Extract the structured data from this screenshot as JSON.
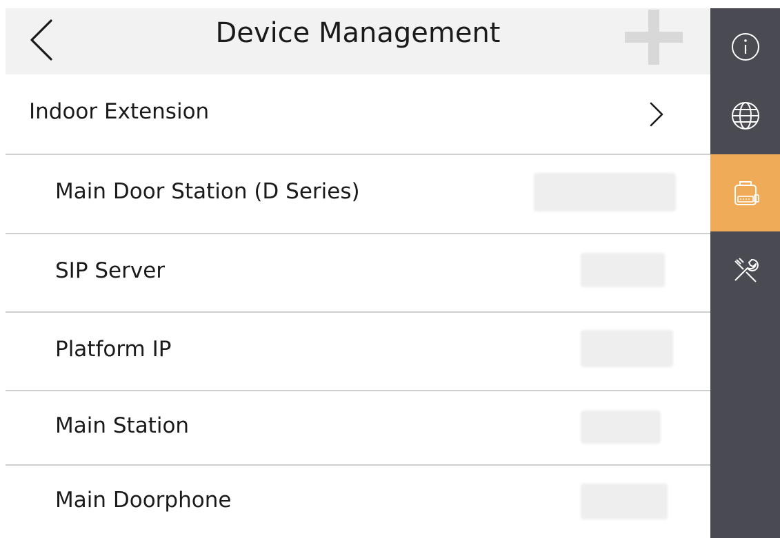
{
  "header": {
    "title": "Device Management",
    "back_icon": "chevron-left-icon",
    "add_icon": "plus-icon"
  },
  "rows": [
    {
      "label": "Indoor Extension",
      "has_chevron": true
    },
    {
      "label": "Main Door Station (D Series)"
    },
    {
      "label": "SIP Server"
    },
    {
      "label": "Platform IP"
    },
    {
      "label": "Main Station"
    },
    {
      "label": "Main Doorphone"
    }
  ],
  "sidebar": {
    "items": [
      {
        "icon": "info-icon",
        "active": false
      },
      {
        "icon": "globe-icon",
        "active": false
      },
      {
        "icon": "device-management-icon",
        "active": true
      },
      {
        "icon": "tools-icon",
        "active": false
      }
    ]
  },
  "colors": {
    "sidebar_bg": "#4a4a52",
    "active_accent": "#efab57",
    "header_bg": "#f2f2f2",
    "divider": "#cfcfcf"
  }
}
